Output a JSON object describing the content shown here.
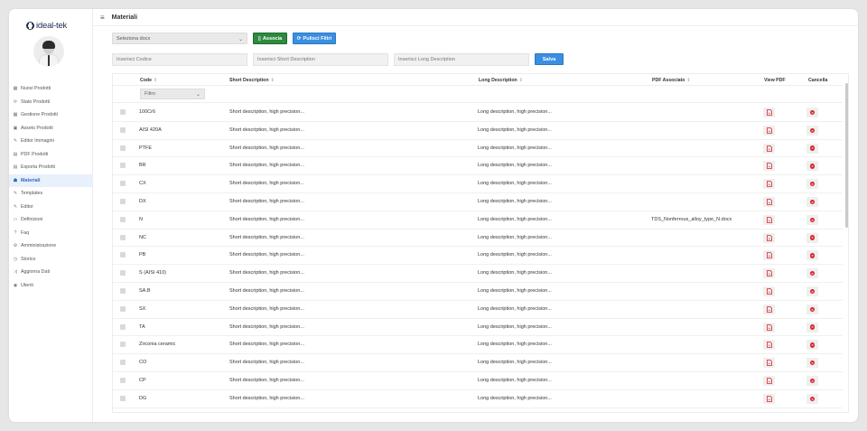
{
  "app": {
    "logo_text": "ideal-tek"
  },
  "sidebar": {
    "items": [
      {
        "label": "Nuovi Prodotti",
        "icon": "grid-icon",
        "glyph": "▦",
        "active": false
      },
      {
        "label": "Stato Prodotti",
        "icon": "refresh-icon",
        "glyph": "⟳",
        "active": false
      },
      {
        "label": "Gestione Prodotti",
        "icon": "grid-icon",
        "glyph": "▦",
        "active": false
      },
      {
        "label": "Assets Prodotti",
        "icon": "image-icon",
        "glyph": "▣",
        "active": false
      },
      {
        "label": "Editor Immagini",
        "icon": "wand-icon",
        "glyph": "✎",
        "active": false
      },
      {
        "label": "PDF Prodotti",
        "icon": "file-icon",
        "glyph": "▤",
        "active": false
      },
      {
        "label": "Esporta Prodotti",
        "icon": "export-icon",
        "glyph": "▤",
        "active": false
      },
      {
        "label": "Materiali",
        "icon": "users-icon",
        "glyph": "☗",
        "active": true
      },
      {
        "label": "Templates",
        "icon": "edit-icon",
        "glyph": "✎",
        "active": false
      },
      {
        "label": "Editor",
        "icon": "edit-icon",
        "glyph": "✎",
        "active": false
      },
      {
        "label": "Definizioni",
        "icon": "calendar-icon",
        "glyph": "▭",
        "active": false
      },
      {
        "label": "Faq",
        "icon": "help-icon",
        "glyph": "?",
        "active": false
      },
      {
        "label": "Amministrazione",
        "icon": "gear-icon",
        "glyph": "⚙",
        "active": false
      },
      {
        "label": "Storico",
        "icon": "history-icon",
        "glyph": "◷",
        "active": false
      },
      {
        "label": "Aggiorna Dati",
        "icon": "shuffle-icon",
        "glyph": "⤨",
        "active": false
      },
      {
        "label": "Utenti",
        "icon": "eye-icon",
        "glyph": "◉",
        "active": false
      }
    ]
  },
  "header": {
    "title": "Materiali"
  },
  "toolbar": {
    "select_docx": "Seleziona docx",
    "associa_label": "Associa",
    "pulisci_label": "Pulisci Filtri",
    "code_placeholder": "Inserisci Codice",
    "short_placeholder": "Inserisci Short Description",
    "long_placeholder": "Inserisci Long Description",
    "salva_label": "Salva"
  },
  "table": {
    "columns": {
      "code": "Code",
      "short": "Short Description",
      "long": "Long Description",
      "pdf": "PDF Associato",
      "view": "View PDF",
      "delete": "Cancella"
    },
    "filter_label": "Filtro",
    "rows": [
      {
        "code": "100Cr6",
        "short": "Short description, high precision...",
        "long": "Long description, high precision...",
        "pdf": ""
      },
      {
        "code": "AISI 420A",
        "short": "Short description, high precision...",
        "long": "Long description, high precision...",
        "pdf": ""
      },
      {
        "code": "PTFE",
        "short": "Short description, high precision...",
        "long": "Long description, high precision...",
        "pdf": ""
      },
      {
        "code": "BR",
        "short": "Short description, high precision...",
        "long": "Long description, high precision...",
        "pdf": ""
      },
      {
        "code": "CX",
        "short": "Short description, high precision...",
        "long": "Long description, high precision...",
        "pdf": ""
      },
      {
        "code": "DX",
        "short": "Short description, high precision...",
        "long": "Long description, high precision...",
        "pdf": ""
      },
      {
        "code": "N",
        "short": "Short description, high precision...",
        "long": "Long description, high precision...",
        "pdf": "TDS_Nonferrous_alloy_type_N.docx"
      },
      {
        "code": "NC",
        "short": "Short description, high precision...",
        "long": "Long description, high precision...",
        "pdf": ""
      },
      {
        "code": "PB",
        "short": "Short description, high precision...",
        "long": "Long description, high precision...",
        "pdf": ""
      },
      {
        "code": "S (AISI 410)",
        "short": "Short description, high precision...",
        "long": "Long description, high precision...",
        "pdf": ""
      },
      {
        "code": "SA.B",
        "short": "Short description, high precision...",
        "long": "Long description, high precision...",
        "pdf": ""
      },
      {
        "code": "SX",
        "short": "Short description, high precision...",
        "long": "Long description, high precision...",
        "pdf": ""
      },
      {
        "code": "TA",
        "short": "Short description, high precision...",
        "long": "Long description, high precision...",
        "pdf": ""
      },
      {
        "code": "Zirconia ceramic",
        "short": "Short description, high precision...",
        "long": "Long description, high precision...",
        "pdf": ""
      },
      {
        "code": "CO",
        "short": "Short description, high precision...",
        "long": "Long description, high precision...",
        "pdf": ""
      },
      {
        "code": "CP",
        "short": "Short description, high precision...",
        "long": "Long description, high precision...",
        "pdf": ""
      },
      {
        "code": "DG",
        "short": "Short description, high precision...",
        "long": "Long description, high precision...",
        "pdf": ""
      }
    ]
  },
  "colors": {
    "accent": "#3a8fe0",
    "associa": "#2d8a3e",
    "delete": "#d9252b",
    "active_nav_bg": "#e8f0fb",
    "active_nav_text": "#2b6cc4"
  }
}
